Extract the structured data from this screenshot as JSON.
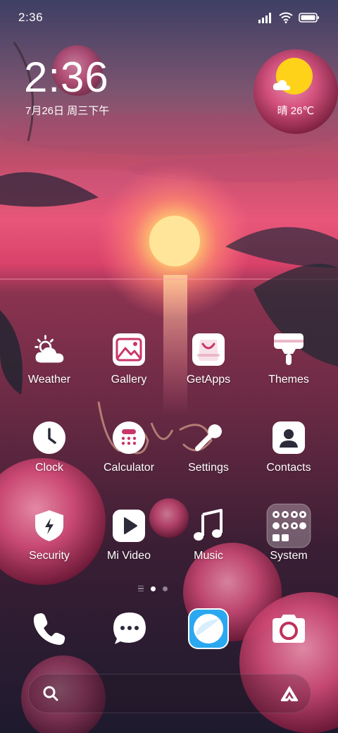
{
  "status_bar": {
    "time": "2:36",
    "icons": [
      "signal-icon",
      "wifi-icon",
      "battery-icon"
    ]
  },
  "clock_widget": {
    "time": "2:36",
    "date": "7月26日 周三下午"
  },
  "weather_widget": {
    "text": "晴 26℃",
    "icon": "sun-cloud-icon"
  },
  "apps": {
    "weather": {
      "label": "Weather",
      "icon": "weather-icon"
    },
    "gallery": {
      "label": "Gallery",
      "icon": "gallery-icon"
    },
    "getapps": {
      "label": "GetApps",
      "icon": "shopping-bag-icon"
    },
    "themes": {
      "label": "Themes",
      "icon": "paint-brush-icon"
    },
    "clock": {
      "label": "Clock",
      "icon": "clock-icon"
    },
    "calculator": {
      "label": "Calculator",
      "icon": "calculator-icon"
    },
    "settings": {
      "label": "Settings",
      "icon": "wrench-icon"
    },
    "contacts": {
      "label": "Contacts",
      "icon": "contact-card-icon"
    },
    "security": {
      "label": "Security",
      "icon": "shield-bolt-icon"
    },
    "mivideo": {
      "label": "Mi Video",
      "icon": "play-icon"
    },
    "music": {
      "label": "Music",
      "icon": "music-note-icon"
    },
    "system": {
      "label": "System",
      "icon": "folder-icon"
    }
  },
  "page_indicator": {
    "pages": 2,
    "active": 1
  },
  "dock": [
    "phone-icon",
    "messages-icon",
    "browser-icon",
    "camera-icon"
  ],
  "search_bar": {
    "left_icon": "search-icon",
    "right_icon": "assistant-icon"
  },
  "colors": {
    "weather_sun": "#ffd21a",
    "browser_icon": "#2aa8f0",
    "camera_accent": "#c0305a"
  }
}
